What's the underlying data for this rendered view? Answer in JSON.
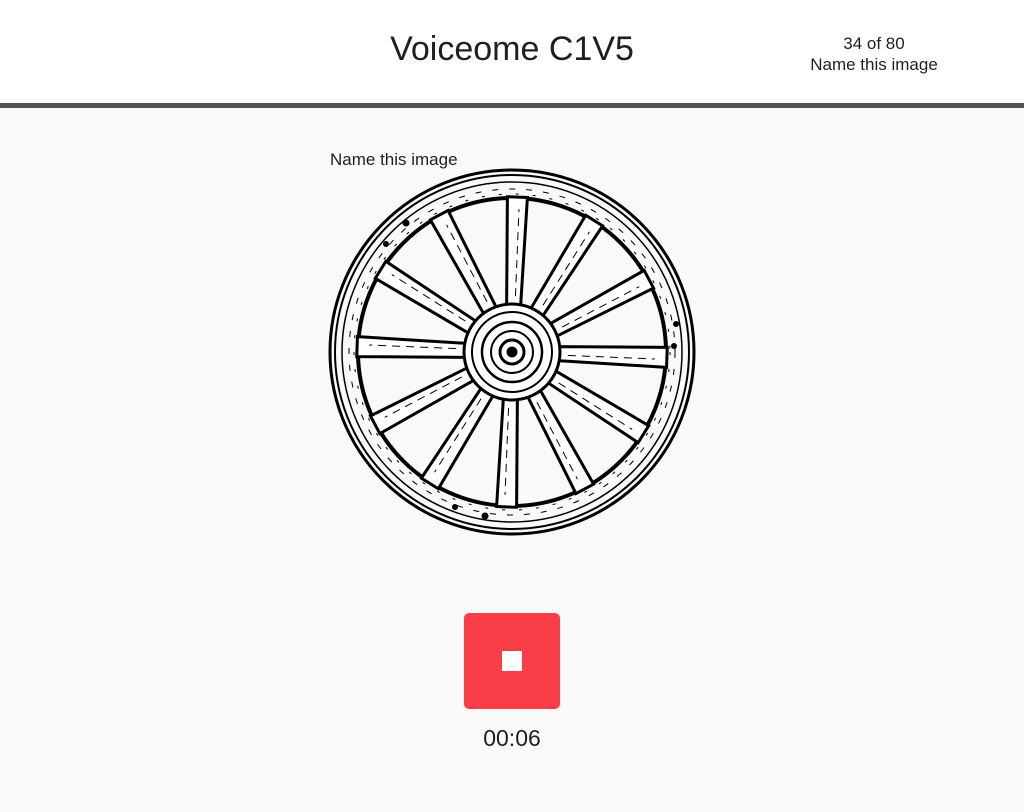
{
  "header": {
    "title": "Voiceome C1V5",
    "progress": "34 of 80",
    "task_name": "Name this image"
  },
  "main": {
    "prompt_label": "Name this image",
    "image_icon": "wagon-wheel-illustration",
    "stop_button_icon": "stop-icon",
    "timer": "00:06"
  },
  "colors": {
    "stop_button": "#f83f47",
    "header_border": "#555555",
    "background": "#f9f9f9"
  }
}
